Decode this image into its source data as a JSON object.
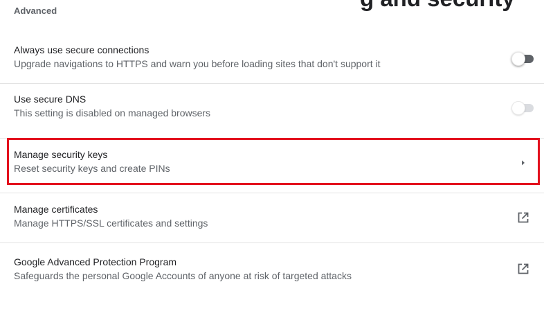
{
  "clipped_heading": "g and security",
  "section_title": "Advanced",
  "rows": [
    {
      "label": "Always use secure connections",
      "sub": "Upgrade navigations to HTTPS and warn you before loading sites that don't support it",
      "control": "toggle",
      "state": "off",
      "disabled": false
    },
    {
      "label": "Use secure DNS",
      "sub": "This setting is disabled on managed browsers",
      "control": "toggle",
      "state": "off",
      "disabled": true
    },
    {
      "label": "Manage security keys",
      "sub": "Reset security keys and create PINs",
      "control": "arrow-right-icon",
      "highlighted": true
    },
    {
      "label": "Manage certificates",
      "sub": "Manage HTTPS/SSL certificates and settings",
      "control": "open-in-new-icon"
    },
    {
      "label": "Google Advanced Protection Program",
      "sub": "Safeguards the personal Google Accounts of anyone at risk of targeted attacks",
      "control": "open-in-new-icon"
    }
  ],
  "colors": {
    "highlight": "#e3121e",
    "text_primary": "#202124",
    "text_secondary": "#5f6368",
    "separator": "#e3e3e3"
  }
}
